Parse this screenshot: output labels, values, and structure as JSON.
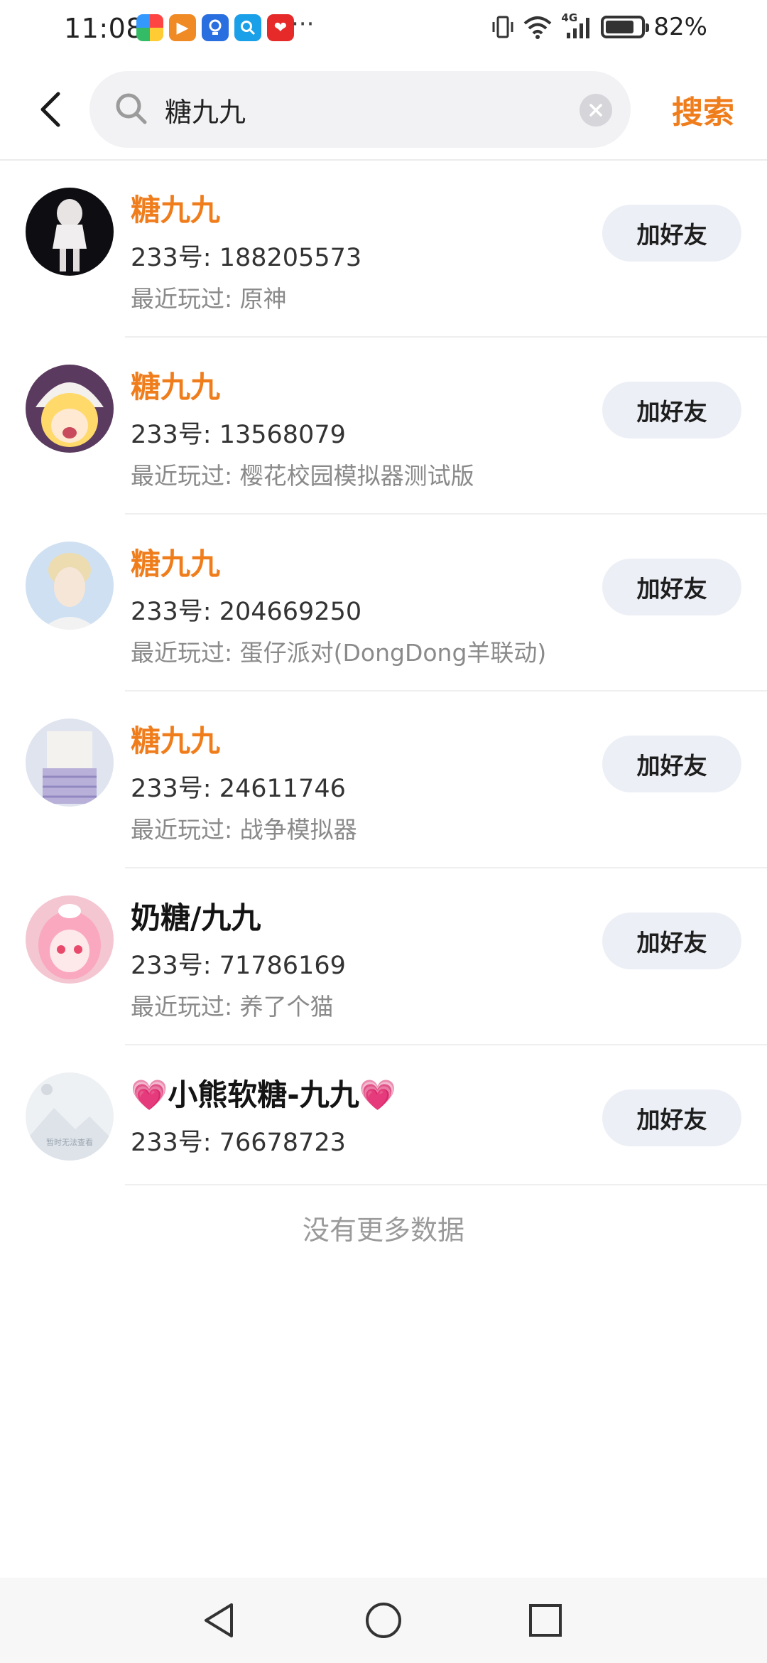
{
  "status_bar": {
    "time": "11:08",
    "network": "4G",
    "battery_level": 0.82,
    "battery_text": "82%",
    "more": "···",
    "app_icons": [
      "colorful-app-icon",
      "video-app-icon",
      "bulb-app-icon",
      "search-app-icon",
      "heart-app-icon"
    ]
  },
  "search": {
    "query": "糖九九",
    "submit_label": "搜索"
  },
  "colors": {
    "accent": "#f07d1c",
    "button_bg": "#eceff5"
  },
  "results": [
    {
      "nickname": "糖九九",
      "highlight": true,
      "id": "233号: 188205573",
      "played": "最近玩过: 原神",
      "button": "加好友"
    },
    {
      "nickname": "糖九九",
      "highlight": true,
      "id": "233号: 13568079",
      "played": "最近玩过: 樱花校园模拟器测试版",
      "button": "加好友"
    },
    {
      "nickname": "糖九九",
      "highlight": true,
      "id": "233号: 204669250",
      "played": "最近玩过: 蛋仔派对(DongDong羊联动)",
      "button": "加好友"
    },
    {
      "nickname": "糖九九",
      "highlight": true,
      "id": "233号: 24611746",
      "played": "最近玩过: 战争模拟器",
      "button": "加好友"
    },
    {
      "nickname": "奶糖/九九",
      "highlight": false,
      "id": "233号: 71786169",
      "played": "最近玩过: 养了个猫",
      "button": "加好友"
    },
    {
      "nickname": "小熊软糖-九九",
      "heart_left": "💗",
      "heart_right": "💗",
      "highlight": false,
      "id": "233号: 76678723",
      "button": "加好友",
      "avatar_placeholder_text": "暂时无法查看"
    }
  ],
  "footer": {
    "no_more": "没有更多数据"
  }
}
